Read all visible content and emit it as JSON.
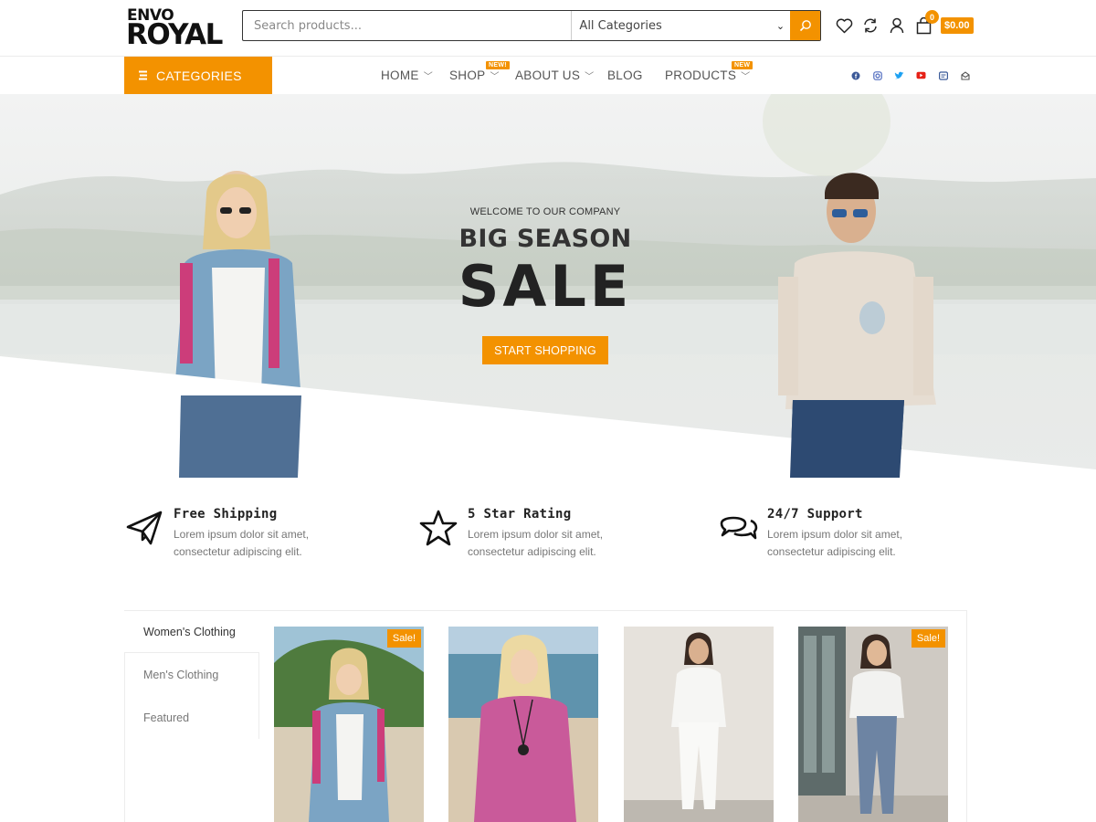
{
  "header": {
    "logo_top": "ENVO",
    "logo_bottom": "ROYAL",
    "search_placeholder": "Search products...",
    "category_select": "All Categories",
    "cart_count": "0",
    "cart_total": "$0.00",
    "icons": [
      "heart-icon",
      "compare-icon",
      "user-icon",
      "shopping-bag-icon",
      "search-icon"
    ]
  },
  "nav": {
    "categories_label": "CATEGORIES",
    "items": [
      {
        "label": "HOME",
        "badge": ""
      },
      {
        "label": "SHOP",
        "badge": "NEW!"
      },
      {
        "label": "ABOUT US",
        "badge": ""
      },
      {
        "label": "BLOG",
        "badge": ""
      },
      {
        "label": "PRODUCTS",
        "badge": "NEW"
      }
    ],
    "social": [
      "facebook-icon",
      "instagram-icon",
      "twitter-icon",
      "youtube-icon",
      "email-icon",
      "message-icon"
    ]
  },
  "hero": {
    "welcome": "WELCOME TO OUR COMPANY",
    "title": "BIG SEASON",
    "sale": "SALE",
    "button": "START SHOPPING"
  },
  "features": [
    {
      "icon": "paper-plane-icon",
      "title": "Free Shipping",
      "text": "Lorem ipsum dolor sit amet, consectetur adipiscing elit."
    },
    {
      "icon": "star-icon",
      "title": "5 Star Rating",
      "text": "Lorem ipsum dolor sit amet, consectetur adipiscing elit."
    },
    {
      "icon": "chat-bubbles-icon",
      "title": "24/7 Support",
      "text": "Lorem ipsum dolor sit amet, consectetur adipiscing elit."
    }
  ],
  "products": {
    "tabs": [
      "Women's Clothing",
      "Men's Clothing",
      "Featured"
    ],
    "active_tab": "Women's Clothing",
    "cards": [
      {
        "sale": "Sale!"
      },
      {
        "sale": ""
      },
      {
        "sale": ""
      },
      {
        "sale": "Sale!"
      }
    ]
  },
  "colors": {
    "accent": "#f39200",
    "text": "#333333",
    "muted": "#777777"
  }
}
